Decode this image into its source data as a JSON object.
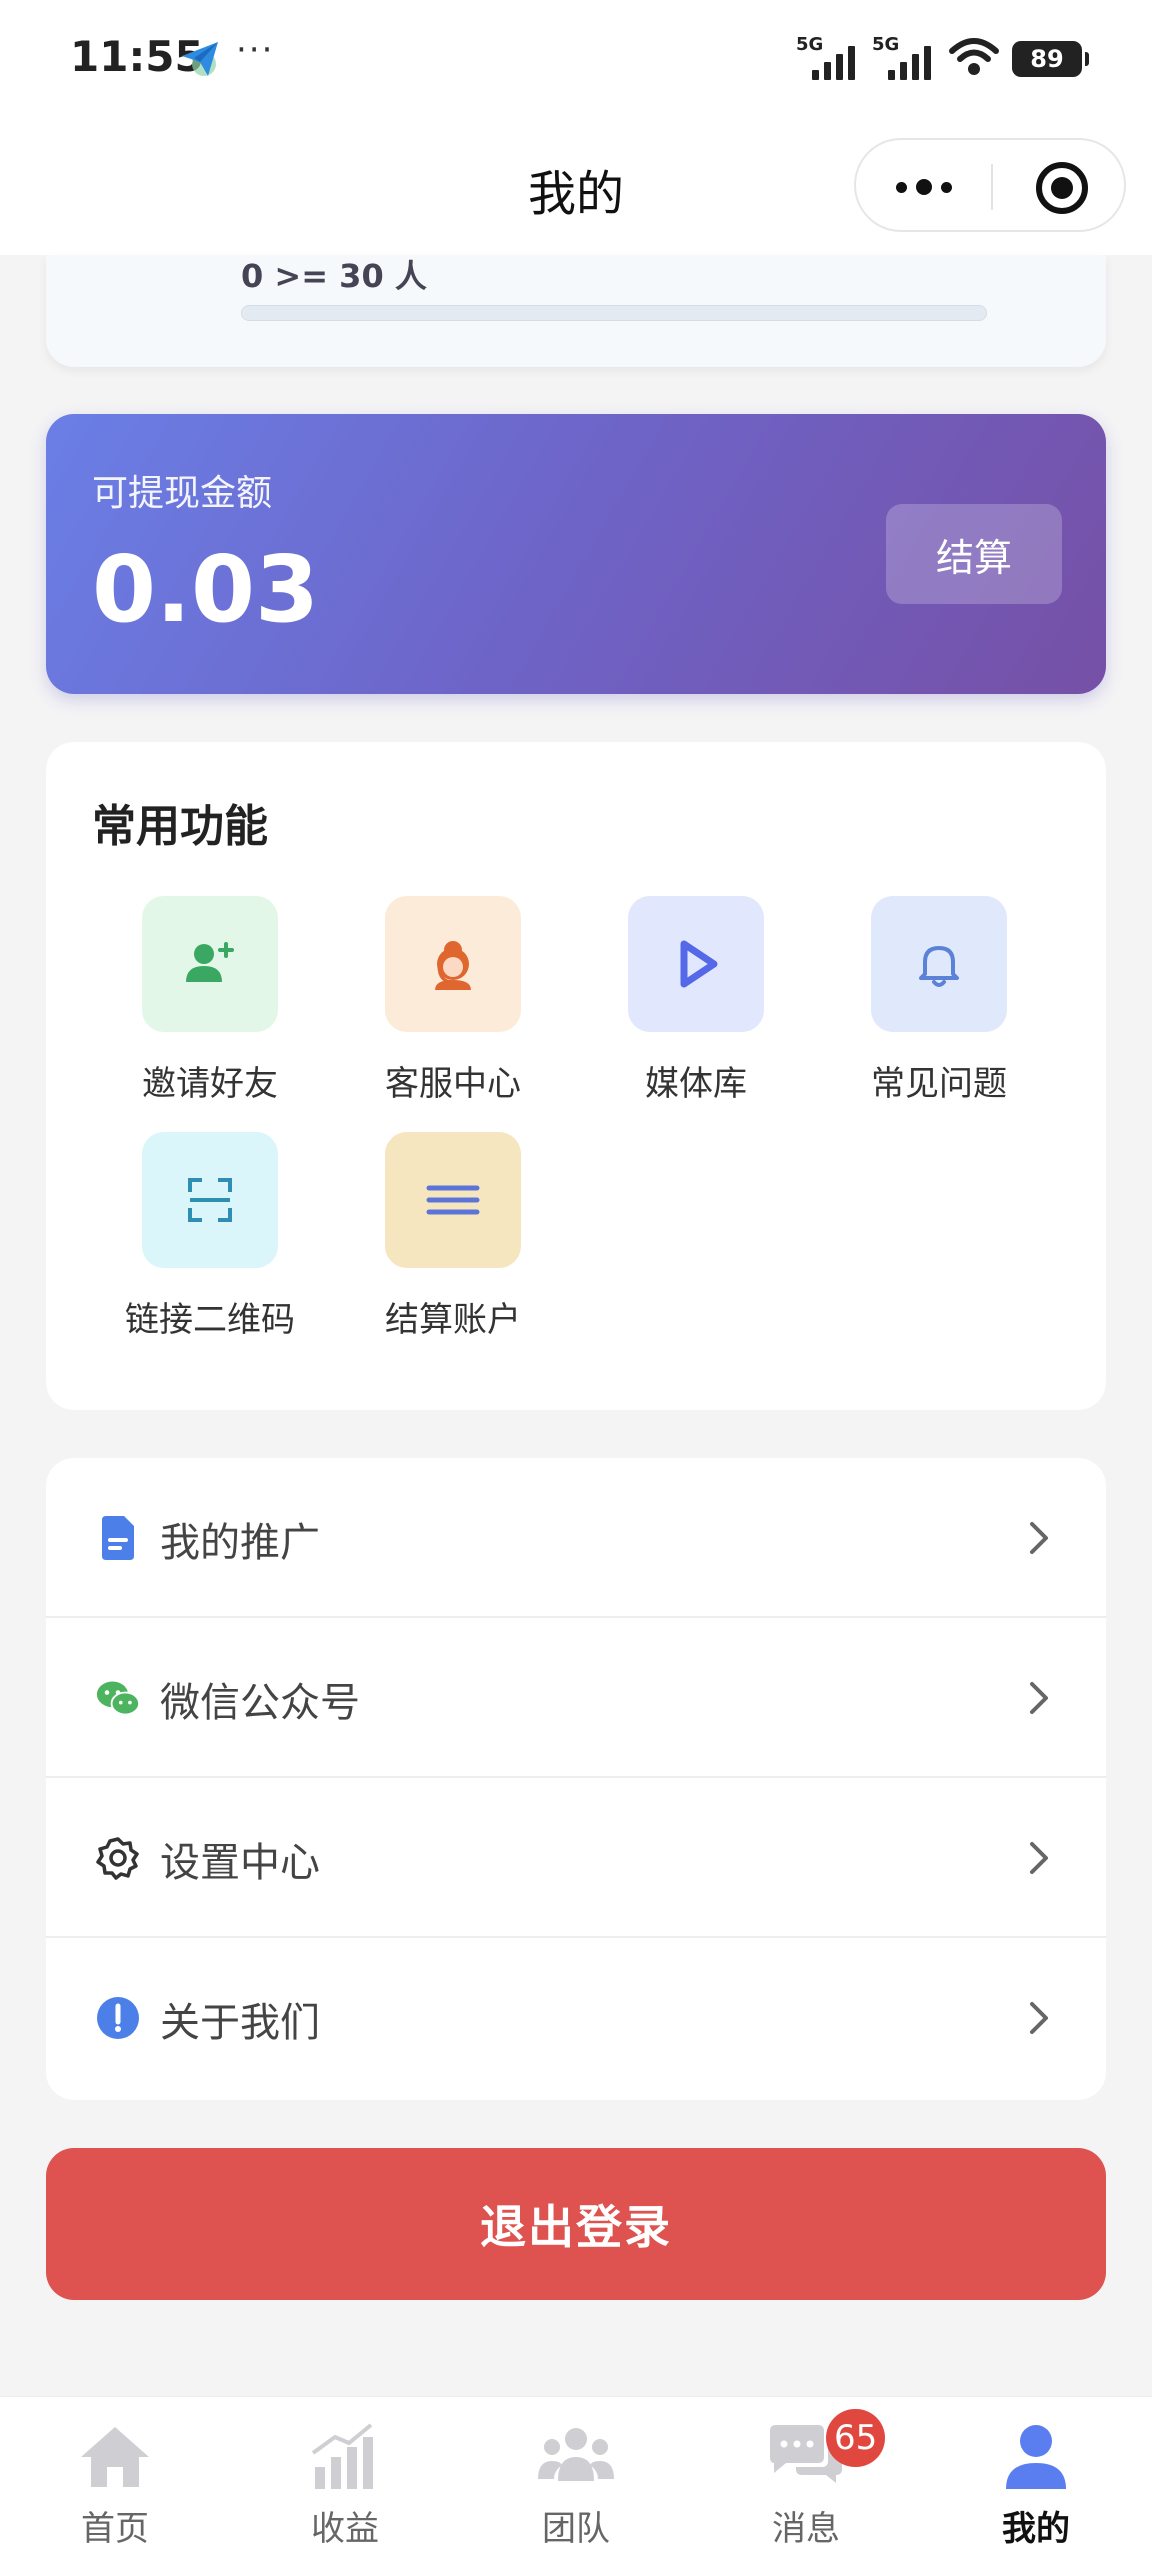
{
  "status_bar": {
    "time": "11:55",
    "more": "···",
    "network_1": "5G",
    "network_2": "5G",
    "battery": "89"
  },
  "header": {
    "title": "我的"
  },
  "progress": {
    "label": "0 >= 30 人",
    "fraction": 0
  },
  "balance": {
    "label": "可提现金额",
    "value": "0.03",
    "settle_label": "结算"
  },
  "features": {
    "title": "常用功能",
    "items": [
      {
        "label": "邀请好友",
        "icon": "add-user-icon",
        "bg": "#e3f7e8",
        "color": "#3aa862"
      },
      {
        "label": "客服中心",
        "icon": "customer-service-icon",
        "bg": "#fdebd9",
        "color": "#e0662f"
      },
      {
        "label": "媒体库",
        "icon": "play-icon",
        "bg": "#e1e7fc",
        "color": "#5468e8"
      },
      {
        "label": "常见问题",
        "icon": "bell-icon",
        "bg": "#dfe9fb",
        "color": "#5b82d6"
      },
      {
        "label": "链接二维码",
        "icon": "scan-icon",
        "bg": "#daf6fb",
        "color": "#2e8fb3"
      },
      {
        "label": "结算账户",
        "icon": "menu-lines-icon",
        "bg": "#f6e6bf",
        "color": "#5b74d8"
      }
    ]
  },
  "menu": {
    "items": [
      {
        "label": "我的推广",
        "icon": "document-icon",
        "color": "#4c80e8"
      },
      {
        "label": "微信公众号",
        "icon": "wechat-icon",
        "color": "#4cb45e"
      },
      {
        "label": "设置中心",
        "icon": "gear-icon",
        "color": "#333333"
      },
      {
        "label": "关于我们",
        "icon": "info-icon",
        "color": "#4c80e8"
      }
    ]
  },
  "logout": {
    "label": "退出登录"
  },
  "tab_bar": {
    "items": [
      {
        "label": "首页",
        "icon": "home-icon"
      },
      {
        "label": "收益",
        "icon": "chart-icon"
      },
      {
        "label": "团队",
        "icon": "team-icon"
      },
      {
        "label": "消息",
        "icon": "message-icon",
        "badge": "65"
      },
      {
        "label": "我的",
        "icon": "user-icon"
      }
    ],
    "active_color": "#5a7ef0",
    "inactive_color": "#cfcfd3"
  },
  "colors": {
    "background": "#f4f4f5",
    "logout": "#de524f",
    "balance_gradient_start": "#6a7fe6",
    "balance_gradient_end": "#7650a6"
  }
}
